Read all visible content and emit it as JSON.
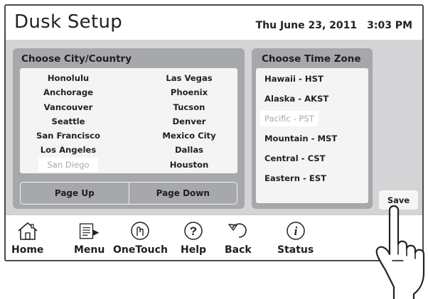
{
  "screen": {
    "title": "Dusk Setup",
    "date": "Thu June 23, 2011",
    "time": "3:03 PM"
  },
  "city_panel": {
    "title": "Choose City/Country",
    "left_column": [
      "Honolulu",
      "Anchorage",
      "Vancouver",
      "Seattle",
      "San Francisco",
      "Los Angeles",
      "San Diego"
    ],
    "right_column": [
      "Las Vegas",
      "Phoenix",
      "Tucson",
      "Denver",
      "Mexico City",
      "Dallas",
      "Houston"
    ],
    "selected": "San Diego",
    "page_up_label": "Page Up",
    "page_down_label": "Page Down"
  },
  "timezone_panel": {
    "title": "Choose Time Zone",
    "zones": [
      "Hawaii - HST",
      "Alaska - AKST",
      "Pacific - PST",
      "Mountain - MST",
      "Central - CST",
      "Eastern - EST"
    ],
    "selected": "Pacific - PST"
  },
  "save_label": "Save",
  "nav": {
    "items": [
      {
        "label": "Home",
        "icon": "house-icon"
      },
      {
        "label": "Menu",
        "icon": "menu-icon"
      },
      {
        "label": "OneTouch",
        "icon": "onetouch-icon"
      },
      {
        "label": "Help",
        "icon": "help-icon"
      },
      {
        "label": "Back",
        "icon": "back-icon"
      },
      {
        "label": "Status",
        "icon": "info-icon"
      }
    ]
  },
  "colors": {
    "panel": "#a7a8ab",
    "content_bg": "#d4d4d6",
    "list_bg": "#f4f4f5",
    "selected_text": "#a8a8a8"
  }
}
